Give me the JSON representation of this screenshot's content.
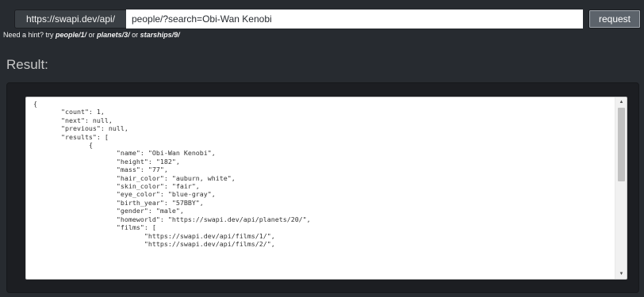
{
  "request": {
    "url_prefix": "https://swapi.dev/api/",
    "query_value": "people/?search=Obi-Wan Kenobi",
    "button_label": "request"
  },
  "hint": {
    "text_before": "Need a hint? try ",
    "link_people": "people/1/",
    "sep1": " or ",
    "link_planets": "planets/3/",
    "sep2": " or ",
    "link_starships": "starships/9/"
  },
  "result": {
    "heading": "Result:",
    "json_text": "{\n\t\"count\": 1,\n\t\"next\": null,\n\t\"previous\": null,\n\t\"results\": [\n\t\t{\n\t\t\t\"name\": \"Obi-Wan Kenobi\",\n\t\t\t\"height\": \"182\",\n\t\t\t\"mass\": \"77\",\n\t\t\t\"hair_color\": \"auburn, white\",\n\t\t\t\"skin_color\": \"fair\",\n\t\t\t\"eye_color\": \"blue-gray\",\n\t\t\t\"birth_year\": \"57BBY\",\n\t\t\t\"gender\": \"male\",\n\t\t\t\"homeworld\": \"https://swapi.dev/api/planets/20/\",\n\t\t\t\"films\": [\n\t\t\t\t\"https://swapi.dev/api/films/1/\",\n\t\t\t\t\"https://swapi.dev/api/films/2/\","
  },
  "icons": {
    "scroll_up": "scroll-up-arrow",
    "scroll_down": "scroll-down-arrow"
  },
  "colors": {
    "page_background": "#272b30",
    "well_background": "#1c1e22",
    "button_background": "#5c636b"
  }
}
